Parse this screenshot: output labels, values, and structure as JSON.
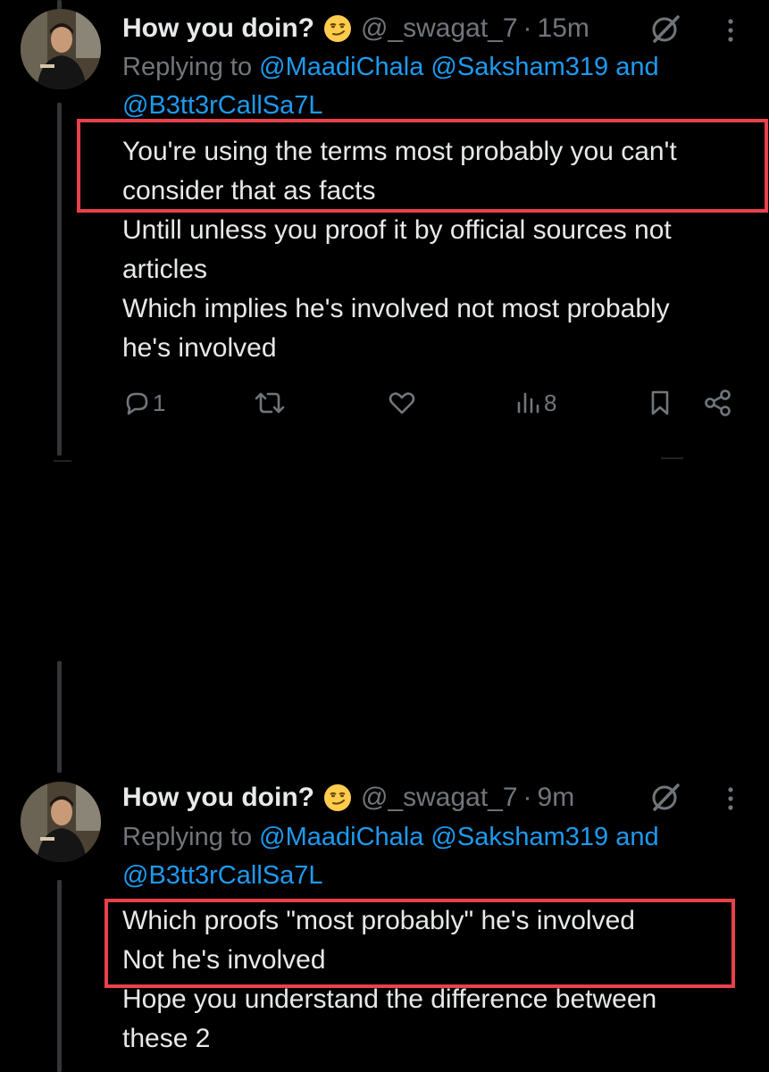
{
  "tweets": [
    {
      "display_name": "How you doin?",
      "handle": "@_swagat_7",
      "separator": "·",
      "time": "15m",
      "reply_prefix": "Replying to",
      "reply_mentions": [
        "@MaadiChala",
        "@Saksham319"
      ],
      "reply_and": "and",
      "reply_mention_last": "@B3tt3rCallSa7L",
      "highlighted_lines": [
        "You're using the terms most probably you can't",
        "consider that as facts"
      ],
      "lines": [
        "Untill unless you proof it by official sources not",
        "articles",
        "Which implies he's involved not most probably",
        "he's involved"
      ],
      "actions": {
        "reply_count": "1",
        "retweet_count": "",
        "like_count": "",
        "views_count": "8"
      },
      "icons": [
        "grok-icon",
        "more-icon",
        "reply-icon",
        "retweet-icon",
        "like-icon",
        "views-icon",
        "bookmark-icon",
        "share-icon"
      ]
    },
    {
      "display_name": "How you doin?",
      "handle": "@_swagat_7",
      "separator": "·",
      "time": "9m",
      "reply_prefix": "Replying to",
      "reply_mentions": [
        "@MaadiChala",
        "@Saksham319"
      ],
      "reply_and": "and",
      "reply_mention_last": "@B3tt3rCallSa7L",
      "highlighted_lines": [
        "Which proofs \"most probably\" he's involved",
        "Not he's involved"
      ],
      "lines": [
        "Hope you understand the difference between",
        "these 2"
      ]
    }
  ],
  "colors": {
    "background": "#000000",
    "text": "#e7e9ea",
    "muted": "#71767b",
    "mention": "#1d9bf0",
    "highlight_box": "#e8414b"
  }
}
